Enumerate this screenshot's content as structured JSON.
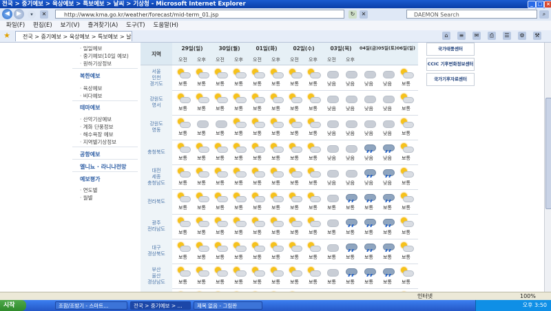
{
  "window": {
    "title": "전국 > 중기예보 > 육상예보 > 특보예보 > 날씨 > 기상청 - Microsoft Internet Explorer"
  },
  "addressbar": {
    "url": "http://www.kma.go.kr/weather/forecast/mid-term_01.jsp",
    "search_placeholder": "DAEMON Search"
  },
  "menu": [
    "파일(F)",
    "편집(E)",
    "보기(V)",
    "즐겨찾기(A)",
    "도구(T)",
    "도움말(H)"
  ],
  "tab": {
    "label": "전국 > 중기예보 > 육상예보 > 특보예보 > 날..."
  },
  "sidebar": {
    "groups": [
      {
        "heading": "",
        "items": [
          "일일예보",
          "중기예보(10일 예보)",
          "원하기상정보"
        ]
      },
      {
        "heading": "복한예보",
        "items": [
          "육상예보",
          "비다예보"
        ]
      },
      {
        "heading": "테마예보",
        "items": [
          "산악기상예보",
          "계화 단풍정보",
          "해수욕장 예보",
          "지역별기상정보"
        ]
      },
      {
        "heading": "공항예보",
        "items": []
      },
      {
        "heading": "엘니뇨 · 라니냐전망",
        "items": []
      },
      {
        "heading": "예보평가",
        "items": [
          "연도별",
          "월별"
        ]
      }
    ]
  },
  "forecast": {
    "region_header": "지역",
    "days": [
      "29일(일)",
      "30일(월)",
      "01일(화)",
      "02일(수)",
      "03일(목)",
      "04일(금)",
      "05일(토)",
      "06일(일)"
    ],
    "am": "오전",
    "pm": "오후",
    "rows": [
      {
        "region": [
          "서울",
          "인천",
          "경기도"
        ],
        "cells": [
          {
            "w": "pc",
            "t": "보통"
          },
          {
            "w": "pc",
            "t": "보통"
          },
          {
            "w": "pc",
            "t": "보통"
          },
          {
            "w": "pc",
            "t": "보통"
          },
          {
            "w": "pc",
            "t": "보통"
          },
          {
            "w": "pc",
            "t": "보통"
          },
          {
            "w": "pc",
            "t": "보통"
          },
          {
            "w": "pc",
            "t": "보통"
          },
          {
            "w": "c",
            "t": "낮음"
          },
          {
            "w": "c",
            "t": "낮음"
          },
          {
            "w": "c",
            "t": "낮음"
          },
          {
            "w": "c",
            "t": "낮음"
          },
          {
            "w": "pc",
            "t": "보통"
          }
        ]
      },
      {
        "region": [
          "강원도",
          "영서"
        ],
        "cells": [
          {
            "w": "pc",
            "t": "보통"
          },
          {
            "w": "pc",
            "t": "보통"
          },
          {
            "w": "pc",
            "t": "보통"
          },
          {
            "w": "pc",
            "t": "보통"
          },
          {
            "w": "pc",
            "t": "보통"
          },
          {
            "w": "pc",
            "t": "보통"
          },
          {
            "w": "pc",
            "t": "보통"
          },
          {
            "w": "pc",
            "t": "보통"
          },
          {
            "w": "c",
            "t": "낮음"
          },
          {
            "w": "c",
            "t": "낮음"
          },
          {
            "w": "c",
            "t": "낮음"
          },
          {
            "w": "c",
            "t": "낮음"
          },
          {
            "w": "pc",
            "t": "보통"
          }
        ]
      },
      {
        "region": [
          "강원도",
          "영동"
        ],
        "cells": [
          {
            "w": "pc",
            "t": "보통"
          },
          {
            "w": "c",
            "t": "보통"
          },
          {
            "w": "c",
            "t": "보통"
          },
          {
            "w": "pc",
            "t": "보통"
          },
          {
            "w": "pc",
            "t": "보통"
          },
          {
            "w": "pc",
            "t": "보통"
          },
          {
            "w": "pc",
            "t": "보통"
          },
          {
            "w": "pc",
            "t": "보통"
          },
          {
            "w": "c",
            "t": "낮음"
          },
          {
            "w": "c",
            "t": "낮음"
          },
          {
            "w": "c",
            "t": "낮음"
          },
          {
            "w": "c",
            "t": "낮음"
          },
          {
            "w": "pc",
            "t": "보통"
          }
        ]
      },
      {
        "region": [
          "충청북도"
        ],
        "cells": [
          {
            "w": "pc",
            "t": "보통"
          },
          {
            "w": "pc",
            "t": "보통"
          },
          {
            "w": "pc",
            "t": "보통"
          },
          {
            "w": "pc",
            "t": "보통"
          },
          {
            "w": "pc",
            "t": "보통"
          },
          {
            "w": "pc",
            "t": "보통"
          },
          {
            "w": "pc",
            "t": "보통"
          },
          {
            "w": "pc",
            "t": "보통"
          },
          {
            "w": "c",
            "t": "낮음"
          },
          {
            "w": "c",
            "t": "낮음"
          },
          {
            "w": "r",
            "t": "낮음"
          },
          {
            "w": "r",
            "t": "낮음"
          },
          {
            "w": "pc",
            "t": "보통"
          }
        ]
      },
      {
        "region": [
          "대전",
          "세종",
          "충청남도"
        ],
        "cells": [
          {
            "w": "pc",
            "t": "보통"
          },
          {
            "w": "pc",
            "t": "보통"
          },
          {
            "w": "pc",
            "t": "보통"
          },
          {
            "w": "pc",
            "t": "보통"
          },
          {
            "w": "pc",
            "t": "보통"
          },
          {
            "w": "pc",
            "t": "보통"
          },
          {
            "w": "pc",
            "t": "보통"
          },
          {
            "w": "pc",
            "t": "보통"
          },
          {
            "w": "c",
            "t": "낮음"
          },
          {
            "w": "c",
            "t": "낮음"
          },
          {
            "w": "r",
            "t": "낮음"
          },
          {
            "w": "r",
            "t": "낮음"
          },
          {
            "w": "pc",
            "t": "보통"
          }
        ]
      },
      {
        "region": [
          "전라북도"
        ],
        "cells": [
          {
            "w": "pc",
            "t": "보통"
          },
          {
            "w": "pc",
            "t": "보통"
          },
          {
            "w": "pc",
            "t": "보통"
          },
          {
            "w": "pc",
            "t": "보통"
          },
          {
            "w": "pc",
            "t": "보통"
          },
          {
            "w": "pc",
            "t": "보통"
          },
          {
            "w": "pc",
            "t": "보통"
          },
          {
            "w": "pc",
            "t": "보통"
          },
          {
            "w": "c",
            "t": "보통"
          },
          {
            "w": "r",
            "t": "보통"
          },
          {
            "w": "r",
            "t": "보통"
          },
          {
            "w": "r",
            "t": "보통"
          },
          {
            "w": "pc",
            "t": "보통"
          }
        ]
      },
      {
        "region": [
          "광주",
          "전라남도"
        ],
        "cells": [
          {
            "w": "pc",
            "t": "보통"
          },
          {
            "w": "pc",
            "t": "보통"
          },
          {
            "w": "pc",
            "t": "보통"
          },
          {
            "w": "pc",
            "t": "보통"
          },
          {
            "w": "pc",
            "t": "보통"
          },
          {
            "w": "pc",
            "t": "보통"
          },
          {
            "w": "pc",
            "t": "보통"
          },
          {
            "w": "pc",
            "t": "보통"
          },
          {
            "w": "c",
            "t": "보통"
          },
          {
            "w": "r",
            "t": "보통"
          },
          {
            "w": "r",
            "t": "보통"
          },
          {
            "w": "r",
            "t": "보통"
          },
          {
            "w": "pc",
            "t": "보통"
          }
        ]
      },
      {
        "region": [
          "대구",
          "경상북도"
        ],
        "cells": [
          {
            "w": "pc",
            "t": "보통"
          },
          {
            "w": "pc",
            "t": "보통"
          },
          {
            "w": "pc",
            "t": "보통"
          },
          {
            "w": "pc",
            "t": "보통"
          },
          {
            "w": "pc",
            "t": "보통"
          },
          {
            "w": "pc",
            "t": "보통"
          },
          {
            "w": "pc",
            "t": "보통"
          },
          {
            "w": "pc",
            "t": "보통"
          },
          {
            "w": "c",
            "t": "보통"
          },
          {
            "w": "r",
            "t": "보통"
          },
          {
            "w": "r",
            "t": "보통"
          },
          {
            "w": "r",
            "t": "보통"
          },
          {
            "w": "pc",
            "t": "보통"
          }
        ]
      },
      {
        "region": [
          "부산",
          "울산",
          "경상남도"
        ],
        "cells": [
          {
            "w": "pc",
            "t": "보통"
          },
          {
            "w": "pc",
            "t": "보통"
          },
          {
            "w": "pc",
            "t": "보통"
          },
          {
            "w": "pc",
            "t": "보통"
          },
          {
            "w": "pc",
            "t": "보통"
          },
          {
            "w": "pc",
            "t": "보통"
          },
          {
            "w": "pc",
            "t": "보통"
          },
          {
            "w": "pc",
            "t": "보통"
          },
          {
            "w": "c",
            "t": "보통"
          },
          {
            "w": "r",
            "t": "보통"
          },
          {
            "w": "r",
            "t": "보통"
          },
          {
            "w": "r",
            "t": "보통"
          },
          {
            "w": "pc",
            "t": "보통"
          }
        ]
      },
      {
        "region": [
          "제주도"
        ],
        "cells": [
          {
            "w": "pc",
            "t": ""
          },
          {
            "w": "pc",
            "t": ""
          },
          {
            "w": "pc",
            "t": ""
          },
          {
            "w": "pc",
            "t": ""
          },
          {
            "w": "pc",
            "t": ""
          },
          {
            "w": "pc",
            "t": ""
          },
          {
            "w": "pc",
            "t": ""
          },
          {
            "w": "c",
            "t": ""
          },
          {
            "w": "r",
            "t": ""
          },
          {
            "w": "r",
            "t": ""
          },
          {
            "w": "r",
            "t": ""
          },
          {
            "w": "r",
            "t": ""
          },
          {
            "w": "pc",
            "t": ""
          }
        ]
      }
    ]
  },
  "banners": [
    "국가태풍센터",
    "CCIC 기후변화정보센터",
    "국가기후자료센터"
  ],
  "status": {
    "zone": "인터넷",
    "zoom": "100%"
  },
  "taskbar": {
    "start": "시작",
    "tasks": [
      "조함/조방기 - 스마트...",
      "전국 > 중기예보 > ...",
      "제목 없음 - 그림판"
    ],
    "clock": "오후 3:50"
  },
  "colors": {
    "rain_icon": "#1e5fc9",
    "sun_icon": "#f6c21b",
    "header_bg": "#e6f0f6"
  }
}
